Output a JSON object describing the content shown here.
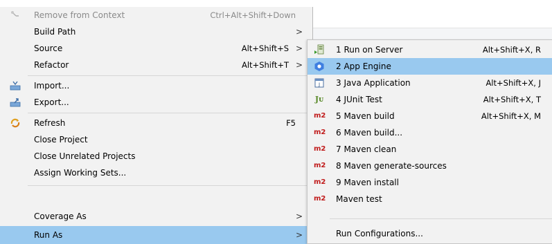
{
  "context_menu": {
    "items": [
      {
        "label": "Remove from Context",
        "shortcut": "Ctrl+Alt+Shift+Down"
      },
      {
        "label": "Build Path"
      },
      {
        "label": "Source",
        "shortcut": "Alt+Shift+S"
      },
      {
        "label": "Refactor",
        "shortcut": "Alt+Shift+T"
      },
      {
        "label": "Import..."
      },
      {
        "label": "Export..."
      },
      {
        "label": "Refresh",
        "shortcut": "F5"
      },
      {
        "label": "Close Project"
      },
      {
        "label": "Close Unrelated Projects"
      },
      {
        "label": "Assign Working Sets..."
      },
      {
        "label": "Coverage As"
      },
      {
        "label": "Run As"
      }
    ],
    "submenu_arrow": ">"
  },
  "run_as_menu": {
    "items": [
      {
        "label": "1 Run on Server",
        "shortcut": "Alt+Shift+X, R"
      },
      {
        "label": "2 App Engine"
      },
      {
        "label": "3 Java Application",
        "shortcut": "Alt+Shift+X, J"
      },
      {
        "label": "4 JUnit Test",
        "shortcut": "Alt+Shift+X, T",
        "icon_text": "Jᴜ"
      },
      {
        "label": "5 Maven build",
        "shortcut": "Alt+Shift+X, M",
        "icon_text": "m2"
      },
      {
        "label": "6 Maven build...",
        "icon_text": "m2"
      },
      {
        "label": "7 Maven clean",
        "icon_text": "m2"
      },
      {
        "label": "8 Maven generate-sources",
        "icon_text": "m2"
      },
      {
        "label": "9 Maven install",
        "icon_text": "m2"
      },
      {
        "label": "Maven test",
        "icon_text": "m2"
      },
      {
        "label": "Run Configurations..."
      }
    ]
  },
  "colors": {
    "menu_bg": "#f2f2f2",
    "selection": "#99c9ef",
    "separator": "#d6d6d6",
    "disabled_text": "#8a8a8a",
    "maven_red": "#c01a1a"
  }
}
